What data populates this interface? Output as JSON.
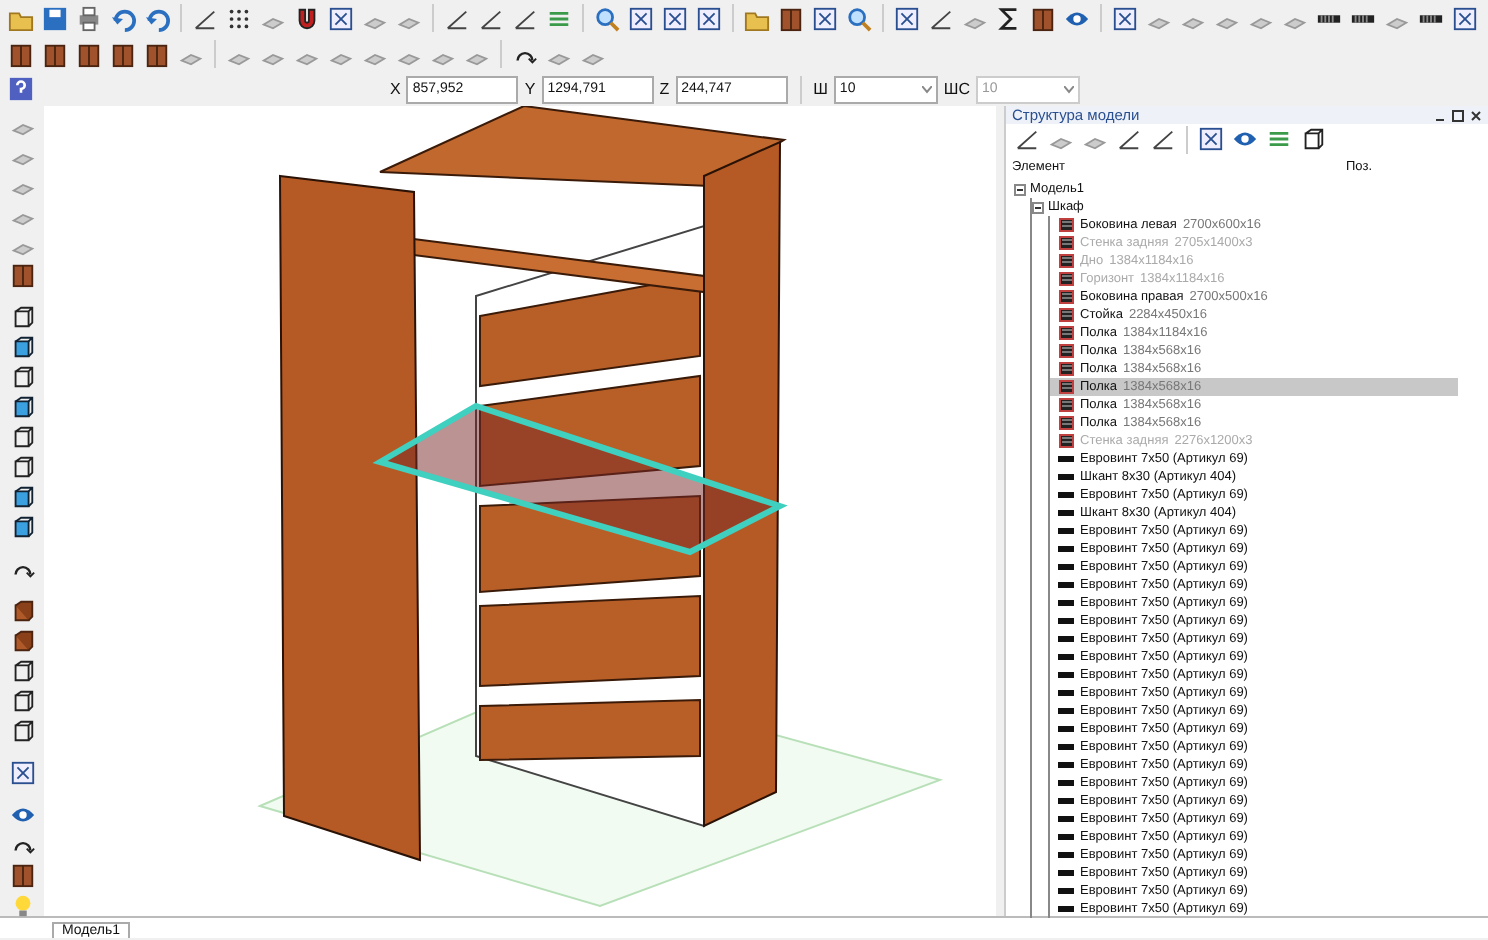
{
  "coordinates": [
    {
      "label": "X",
      "value": "857,952"
    },
    {
      "label": "Y",
      "value": "1294,791"
    },
    {
      "label": "Z",
      "value": "244,747"
    }
  ],
  "selects": [
    {
      "label": "Ш",
      "value": "10",
      "disabled": false
    },
    {
      "label": "ШС",
      "value": "10",
      "disabled": true
    }
  ],
  "panel": {
    "title": "Структура модели",
    "columns": [
      "Элемент",
      "Поз."
    ],
    "tree": [
      {
        "label": "Модель1",
        "expanded": true,
        "children": [
          {
            "label": "Шкаф",
            "expanded": true,
            "children": [
              {
                "kind": "panel",
                "name": "Боковина левая",
                "size": "2700x600x16",
                "disabled": false,
                "selected": false
              },
              {
                "kind": "panel",
                "name": "Стенка задняя",
                "size": "2705x1400x3",
                "disabled": true,
                "selected": false
              },
              {
                "kind": "panel",
                "name": "Дно",
                "size": "1384x1184x16",
                "disabled": true,
                "selected": false
              },
              {
                "kind": "panel",
                "name": "Горизонт",
                "size": "1384x1184x16",
                "disabled": true,
                "selected": false
              },
              {
                "kind": "panel",
                "name": "Боковина правая",
                "size": "2700x500x16",
                "disabled": false,
                "selected": false
              },
              {
                "kind": "panel",
                "name": "Стойка",
                "size": "2284x450x16",
                "disabled": false,
                "selected": false
              },
              {
                "kind": "panel",
                "name": "Полка",
                "size": "1384x1184x16",
                "disabled": false,
                "selected": false
              },
              {
                "kind": "panel",
                "name": "Полка",
                "size": "1384x568x16",
                "disabled": false,
                "selected": false
              },
              {
                "kind": "panel",
                "name": "Полка",
                "size": "1384x568x16",
                "disabled": false,
                "selected": false
              },
              {
                "kind": "panel",
                "name": "Полка",
                "size": "1384x568x16",
                "disabled": false,
                "selected": true
              },
              {
                "kind": "panel",
                "name": "Полка",
                "size": "1384x568x16",
                "disabled": false,
                "selected": false
              },
              {
                "kind": "panel",
                "name": "Полка",
                "size": "1384x568x16",
                "disabled": false,
                "selected": false
              },
              {
                "kind": "panel",
                "name": "Стенка задняя",
                "size": "2276x1200x3",
                "disabled": true,
                "selected": false
              },
              {
                "kind": "fastener",
                "name": "Евровинт 7x50 (Артикул 69)",
                "disabled": false,
                "selected": false
              },
              {
                "kind": "fastener",
                "name": "Шкант 8x30 (Артикул 404)",
                "disabled": false,
                "selected": false
              },
              {
                "kind": "fastener",
                "name": "Евровинт 7x50 (Артикул 69)",
                "disabled": false,
                "selected": false
              },
              {
                "kind": "fastener",
                "name": "Шкант 8x30 (Артикул 404)",
                "disabled": false,
                "selected": false
              },
              {
                "kind": "fastener",
                "name": "Евровинт 7x50 (Артикул 69)",
                "disabled": false,
                "selected": false
              },
              {
                "kind": "fastener",
                "name": "Евровинт 7x50 (Артикул 69)",
                "disabled": false,
                "selected": false
              },
              {
                "kind": "fastener",
                "name": "Евровинт 7x50 (Артикул 69)",
                "disabled": false,
                "selected": false
              },
              {
                "kind": "fastener",
                "name": "Евровинт 7x50 (Артикул 69)",
                "disabled": false,
                "selected": false
              },
              {
                "kind": "fastener",
                "name": "Евровинт 7x50 (Артикул 69)",
                "disabled": false,
                "selected": false
              },
              {
                "kind": "fastener",
                "name": "Евровинт 7x50 (Артикул 69)",
                "disabled": false,
                "selected": false
              },
              {
                "kind": "fastener",
                "name": "Евровинт 7x50 (Артикул 69)",
                "disabled": false,
                "selected": false
              },
              {
                "kind": "fastener",
                "name": "Евровинт 7x50 (Артикул 69)",
                "disabled": false,
                "selected": false
              },
              {
                "kind": "fastener",
                "name": "Евровинт 7x50 (Артикул 69)",
                "disabled": false,
                "selected": false
              },
              {
                "kind": "fastener",
                "name": "Евровинт 7x50 (Артикул 69)",
                "disabled": false,
                "selected": false
              },
              {
                "kind": "fastener",
                "name": "Евровинт 7x50 (Артикул 69)",
                "disabled": false,
                "selected": false
              },
              {
                "kind": "fastener",
                "name": "Евровинт 7x50 (Артикул 69)",
                "disabled": false,
                "selected": false
              },
              {
                "kind": "fastener",
                "name": "Евровинт 7x50 (Артикул 69)",
                "disabled": false,
                "selected": false
              },
              {
                "kind": "fastener",
                "name": "Евровинт 7x50 (Артикул 69)",
                "disabled": false,
                "selected": false
              },
              {
                "kind": "fastener",
                "name": "Евровинт 7x50 (Артикул 69)",
                "disabled": false,
                "selected": false
              },
              {
                "kind": "fastener",
                "name": "Евровинт 7x50 (Артикул 69)",
                "disabled": false,
                "selected": false
              },
              {
                "kind": "fastener",
                "name": "Евровинт 7x50 (Артикул 69)",
                "disabled": false,
                "selected": false
              },
              {
                "kind": "fastener",
                "name": "Евровинт 7x50 (Артикул 69)",
                "disabled": false,
                "selected": false
              },
              {
                "kind": "fastener",
                "name": "Евровинт 7x50 (Артикул 69)",
                "disabled": false,
                "selected": false
              },
              {
                "kind": "fastener",
                "name": "Евровинт 7x50 (Артикул 69)",
                "disabled": false,
                "selected": false
              },
              {
                "kind": "fastener",
                "name": "Евровинт 7x50 (Артикул 69)",
                "disabled": false,
                "selected": false
              },
              {
                "kind": "fastener",
                "name": "Евровинт 7x50 (Артикул 69)",
                "disabled": false,
                "selected": false
              }
            ]
          }
        ]
      }
    ]
  },
  "status_bar": {
    "tab": "Модель1"
  }
}
